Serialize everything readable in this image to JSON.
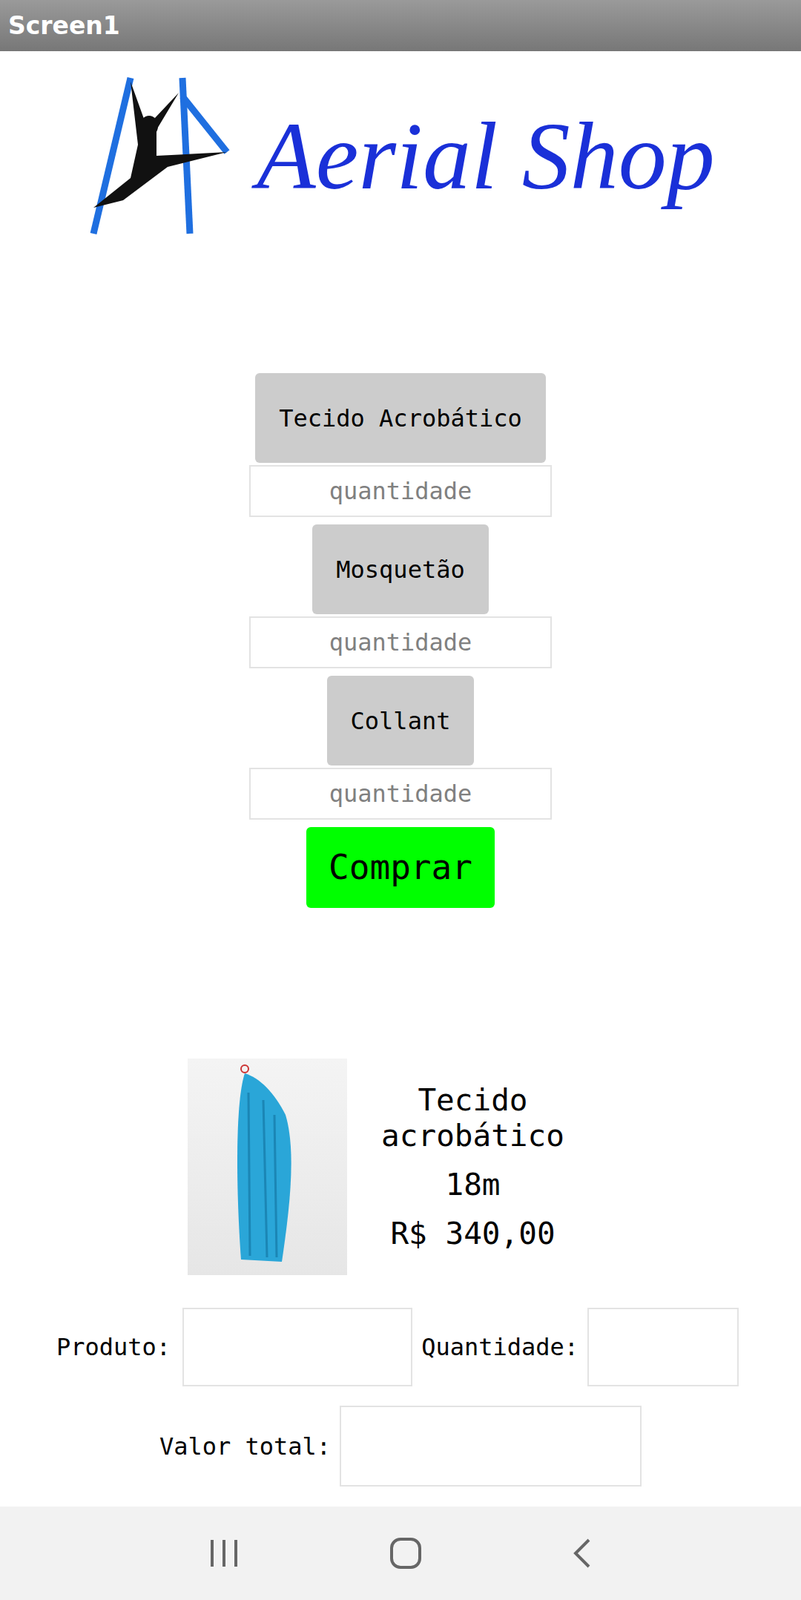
{
  "window": {
    "title": "Screen1"
  },
  "logo": {
    "text": "Aerial Shop"
  },
  "products": [
    {
      "label": "Tecido Acrobático",
      "placeholder": "quantidade"
    },
    {
      "label": "Mosquetão",
      "placeholder": "quantidade"
    },
    {
      "label": "Collant",
      "placeholder": "quantidade"
    }
  ],
  "buy_button": "Comprar",
  "product_card": {
    "name": "Tecido acrobático",
    "size": "18m",
    "price": "R$ 340,00"
  },
  "summary": {
    "product_label": "Produto:",
    "product_value": "",
    "quantity_label": "Quantidade:",
    "quantity_value": "",
    "total_label": "Valor total:",
    "total_value": ""
  }
}
